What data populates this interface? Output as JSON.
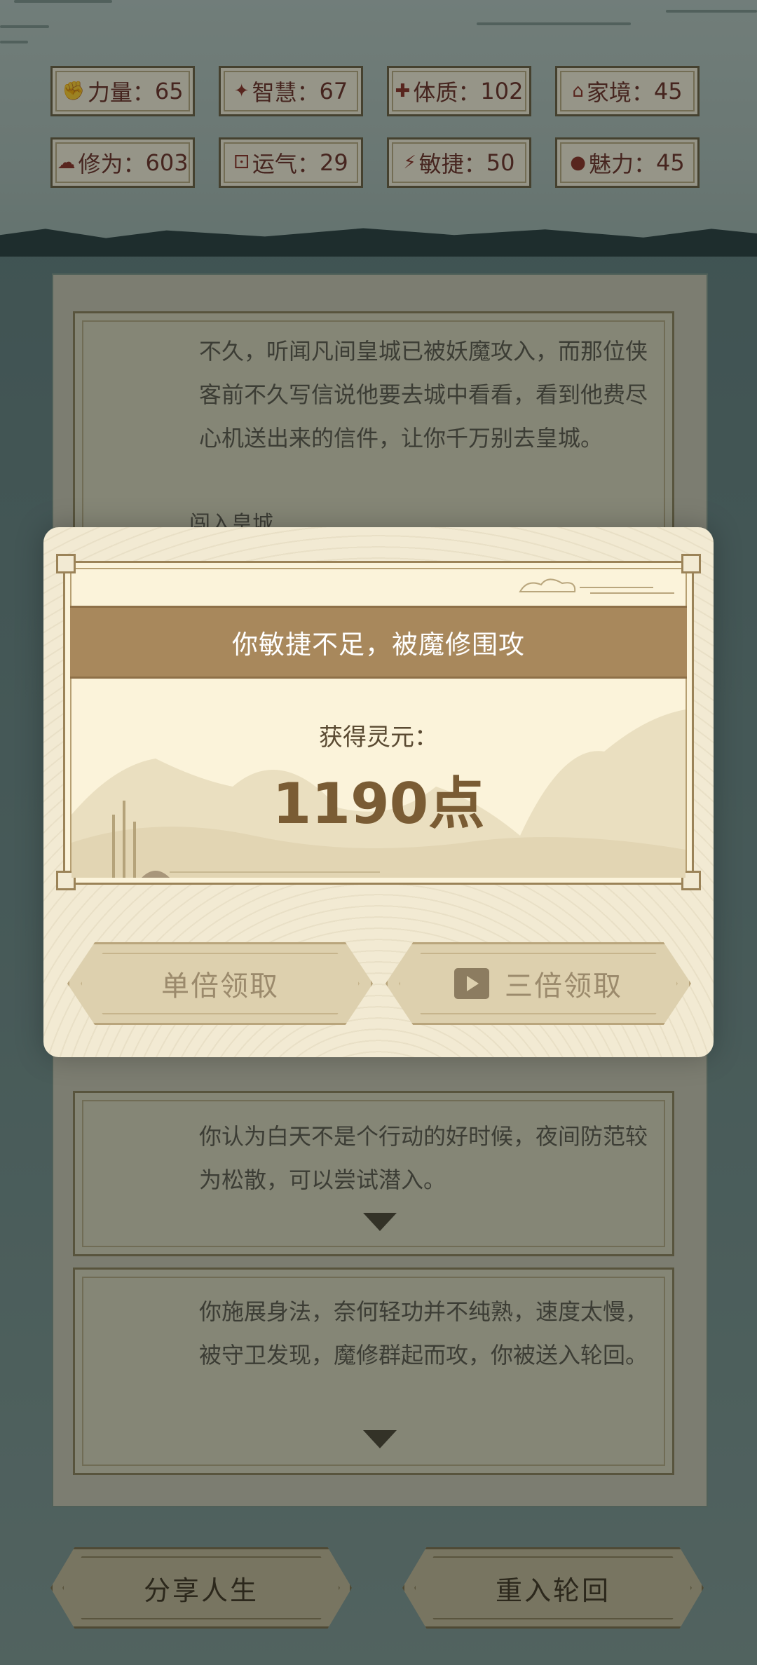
{
  "stats": [
    {
      "icon": "fist-icon",
      "glyph": "✊",
      "label": "力量",
      "value": "65"
    },
    {
      "icon": "bulb-icon",
      "glyph": "✦",
      "label": "智慧",
      "value": "67"
    },
    {
      "icon": "heart-plus-icon",
      "glyph": "✚",
      "label": "体质",
      "value": "102"
    },
    {
      "icon": "house-icon",
      "glyph": "⌂",
      "label": "家境",
      "value": "45"
    },
    {
      "icon": "cloud-icon",
      "glyph": "☁",
      "label": "修为",
      "value": "603"
    },
    {
      "icon": "dice-icon",
      "glyph": "⚀",
      "label": "运气",
      "value": "29"
    },
    {
      "icon": "lightning-icon",
      "glyph": "⚡",
      "label": "敏捷",
      "value": "50"
    },
    {
      "icon": "face-icon",
      "glyph": "●",
      "label": "魅力",
      "value": "45"
    }
  ],
  "story": {
    "card1_text": "不久，听闻凡间皇城已被妖魔攻入，而那位侠客前不久写信说他要去城中看看，看到他费尽心机送出来的信件，让你千万别去皇城。",
    "card1_choice": "闯入皇城",
    "card2_text": "你认为白天不是个行动的好时候，夜间防范较为松散，可以尝试潜入。",
    "card3_text": "你施展身法，奈何轻功并不纯熟，速度太慢，被守卫发现，魔修群起而攻，你被送入轮回。"
  },
  "modal": {
    "title": "你敏捷不足，被魔修围攻",
    "reward_label": "获得灵元：",
    "reward_value": "1190点",
    "single_button": "单倍领取",
    "triple_button": "三倍领取"
  },
  "bottom": {
    "share_button": "分享人生",
    "restart_button": "重入轮回"
  },
  "colors": {
    "accent": "#a8885c",
    "stat_text": "#6b2a22",
    "reward_text": "#7a5c34"
  }
}
